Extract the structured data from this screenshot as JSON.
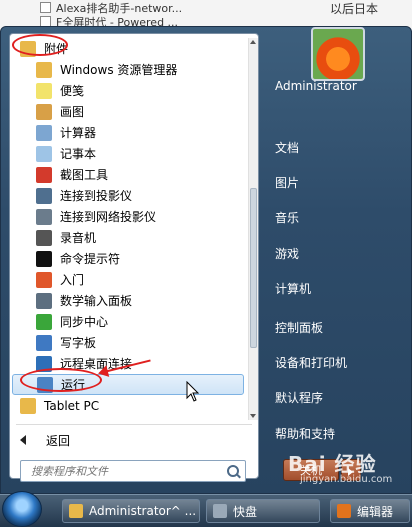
{
  "background_window": {
    "rows": [
      "Alexa排名助手-networ...",
      "F全屏时代 - Powered ..."
    ],
    "right_text": "以后日本"
  },
  "start_menu": {
    "programs": [
      {
        "label": "附件",
        "icon": "folder-icon",
        "color": "#e8b84a",
        "folder": true
      },
      {
        "label": "Windows 资源管理器",
        "icon": "explorer-icon",
        "color": "#e8b84a"
      },
      {
        "label": "便笺",
        "icon": "sticky-notes-icon",
        "color": "#f2e36b"
      },
      {
        "label": "画图",
        "icon": "paint-icon",
        "color": "#d8a047"
      },
      {
        "label": "计算器",
        "icon": "calculator-icon",
        "color": "#7da6d1"
      },
      {
        "label": "记事本",
        "icon": "notepad-icon",
        "color": "#9ec4e6"
      },
      {
        "label": "截图工具",
        "icon": "snipping-tool-icon",
        "color": "#d33a2c"
      },
      {
        "label": "连接到投影仪",
        "icon": "projector-icon",
        "color": "#4f6f8f"
      },
      {
        "label": "连接到网络投影仪",
        "icon": "network-projector-icon",
        "color": "#6b7c8c"
      },
      {
        "label": "录音机",
        "icon": "microphone-icon",
        "color": "#555555"
      },
      {
        "label": "命令提示符",
        "icon": "command-prompt-icon",
        "color": "#111111"
      },
      {
        "label": "入门",
        "icon": "getting-started-icon",
        "color": "#e0572b"
      },
      {
        "label": "数学输入面板",
        "icon": "math-input-icon",
        "color": "#5d6f80"
      },
      {
        "label": "同步中心",
        "icon": "sync-center-icon",
        "color": "#3aa63a"
      },
      {
        "label": "写字板",
        "icon": "wordpad-icon",
        "color": "#3f79c2"
      },
      {
        "label": "远程桌面连接",
        "icon": "remote-desktop-icon",
        "color": "#2d6fb8"
      },
      {
        "label": "运行",
        "icon": "run-icon",
        "color": "#4a83c4",
        "selected": true
      },
      {
        "label": "Tablet PC",
        "icon": "folder-icon",
        "color": "#e8b84a",
        "folder": true
      }
    ],
    "back_label": "返回",
    "search_placeholder": "搜索程序和文件",
    "user_name": "Administrator",
    "right_items": [
      "文档",
      "图片",
      "音乐",
      "游戏",
      "计算机",
      "控制面板",
      "设备和打印机",
      "默认程序",
      "帮助和支持"
    ],
    "shutdown_label": "关机"
  },
  "taskbar": {
    "buttons": [
      {
        "label": "Administrator^ ...",
        "icon": "folder-icon",
        "color": "#e8b84a"
      },
      {
        "label": "快盘",
        "icon": "drive-icon",
        "color": "#9aa9b8"
      },
      {
        "label": "编辑器",
        "icon": "firefox-icon",
        "color": "#e2731d"
      }
    ]
  },
  "watermark": {
    "text": "Bai 经验",
    "sub": "jingyan.baidu.com"
  },
  "accent_colors": {
    "annotation": "#e0201f",
    "selection": "#cfe4f7"
  }
}
